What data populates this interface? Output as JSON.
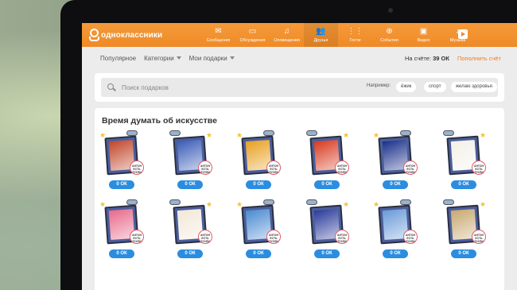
{
  "header": {
    "logo_text": "одноклассники",
    "nav": [
      {
        "label": "Сообщения",
        "icon": "envelope-icon",
        "glyph": "✉"
      },
      {
        "label": "Обсуждения",
        "icon": "chat-icon",
        "glyph": "▭"
      },
      {
        "label": "Оповещения",
        "icon": "bell-icon",
        "glyph": "♫"
      },
      {
        "label": "Друзья",
        "icon": "friends-icon",
        "glyph": "👥"
      },
      {
        "label": "Гости",
        "icon": "footprints-icon",
        "glyph": "⋮⋮"
      },
      {
        "label": "События",
        "icon": "events-icon",
        "glyph": "⊕"
      },
      {
        "label": "Видео",
        "icon": "video-camera-icon",
        "glyph": "▣"
      },
      {
        "label": "Музыка",
        "icon": "music-note-icon",
        "glyph": "♪"
      }
    ]
  },
  "subnav": {
    "popular": "Популярное",
    "categories": "Категории",
    "my_gifts": "Мои подарки",
    "balance_label": "На счёте:",
    "balance_value": "39 ОК",
    "topup": "Пополнить счёт"
  },
  "search": {
    "placeholder": "Поиск подарков",
    "example_label": "Например:",
    "chips": [
      "ёжик",
      "спорт",
      "желаю здоровья"
    ]
  },
  "section": {
    "title": "Время думать об искусстве",
    "sticker_text": "АНТОН ЕСТЬ ТУХЛИ",
    "gifts": [
      {
        "price": "0 ОК",
        "art": "#c0462a"
      },
      {
        "price": "0 ОК",
        "art": "#3a5db8"
      },
      {
        "price": "0 ОК",
        "art": "#e8a020"
      },
      {
        "price": "0 ОК",
        "art": "#d83a1e"
      },
      {
        "price": "0 ОК",
        "art": "#1a2f8a"
      },
      {
        "price": "0 ОК",
        "art": "#f4f0e8"
      },
      {
        "price": "0 ОК",
        "art": "#e86a8a"
      },
      {
        "price": "0 ОК",
        "art": "#f2e8d8"
      },
      {
        "price": "0 ОК",
        "art": "#4a8ad0"
      },
      {
        "price": "0 ОК",
        "art": "#2a3a9a"
      },
      {
        "price": "0 ОК",
        "art": "#6a9ad8"
      },
      {
        "price": "0 ОК",
        "art": "#c8a870"
      }
    ]
  },
  "colors": {
    "brand": "#ef8a26",
    "price_button": "#2b8de0",
    "topup_link": "#ef7d1a"
  }
}
